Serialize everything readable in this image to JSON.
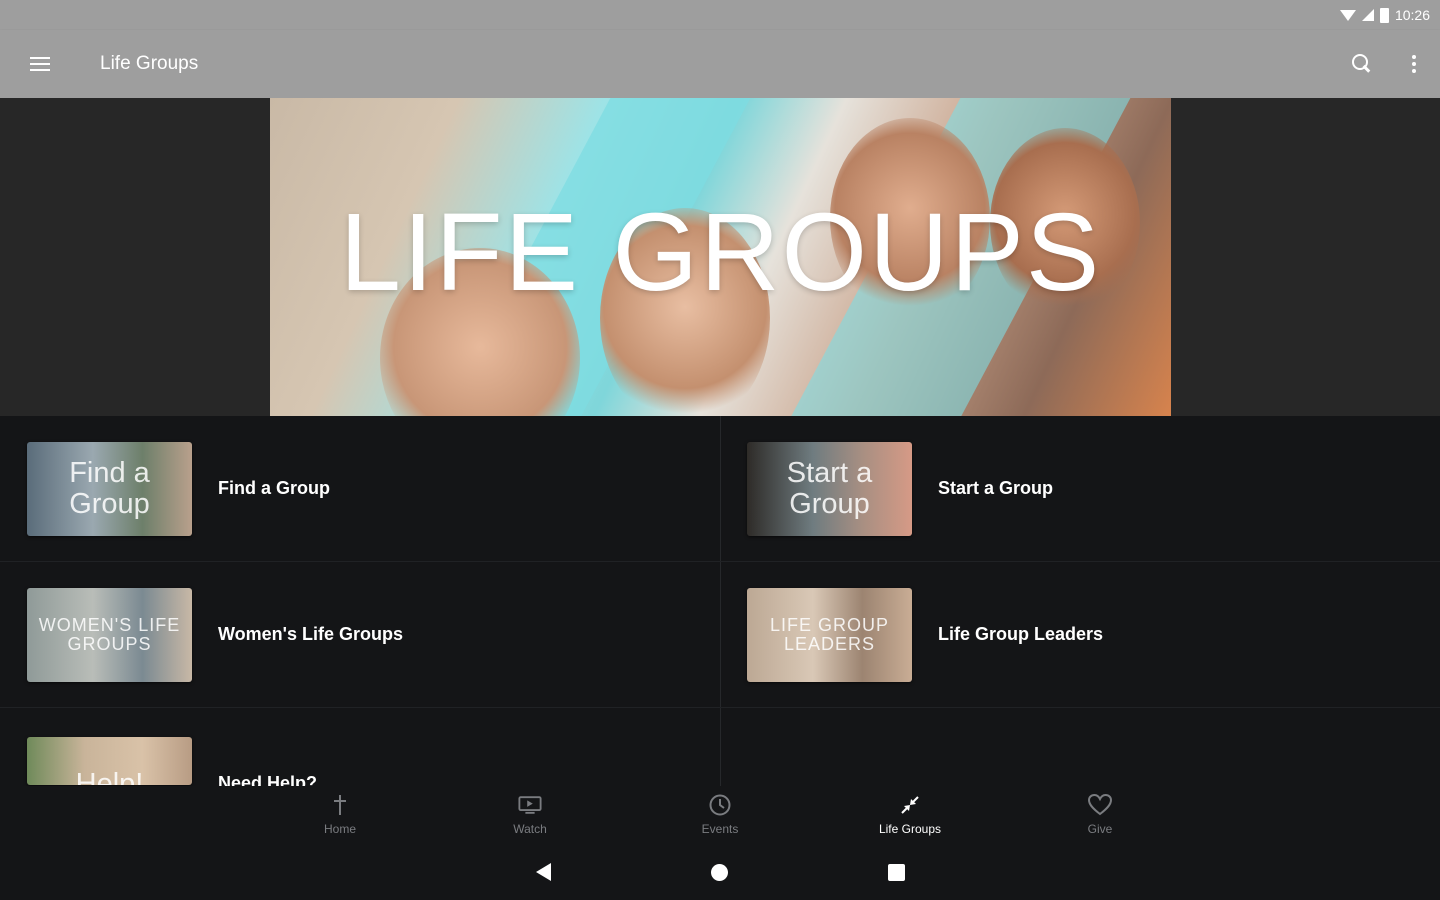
{
  "status_bar": {
    "time": "10:26"
  },
  "app_bar": {
    "title": "Life Groups"
  },
  "hero": {
    "title": "LIFE GROUPS"
  },
  "tiles": [
    {
      "thumb_text": "Find a Group",
      "label": "Find a Group"
    },
    {
      "thumb_text": "Start a Group",
      "label": "Start a Group"
    },
    {
      "thumb_text": "WOMEN'S LIFE GROUPS",
      "label": "Women's Life Groups"
    },
    {
      "thumb_text": "LIFE GROUP LEADERS",
      "label": "Life Group Leaders"
    },
    {
      "thumb_text": "Help!",
      "label": "Need Help?"
    }
  ],
  "bottom_nav": {
    "items": [
      {
        "label": "Home",
        "icon": "cross-icon"
      },
      {
        "label": "Watch",
        "icon": "tv-icon"
      },
      {
        "label": "Events",
        "icon": "clock-icon"
      },
      {
        "label": "Life Groups",
        "icon": "connect-arrows-icon",
        "active": true
      },
      {
        "label": "Give",
        "icon": "heart-icon"
      }
    ]
  },
  "colors": {
    "app_bar": "#9e9e9e",
    "background": "#141517",
    "accent_teal": "#7fd6da"
  }
}
